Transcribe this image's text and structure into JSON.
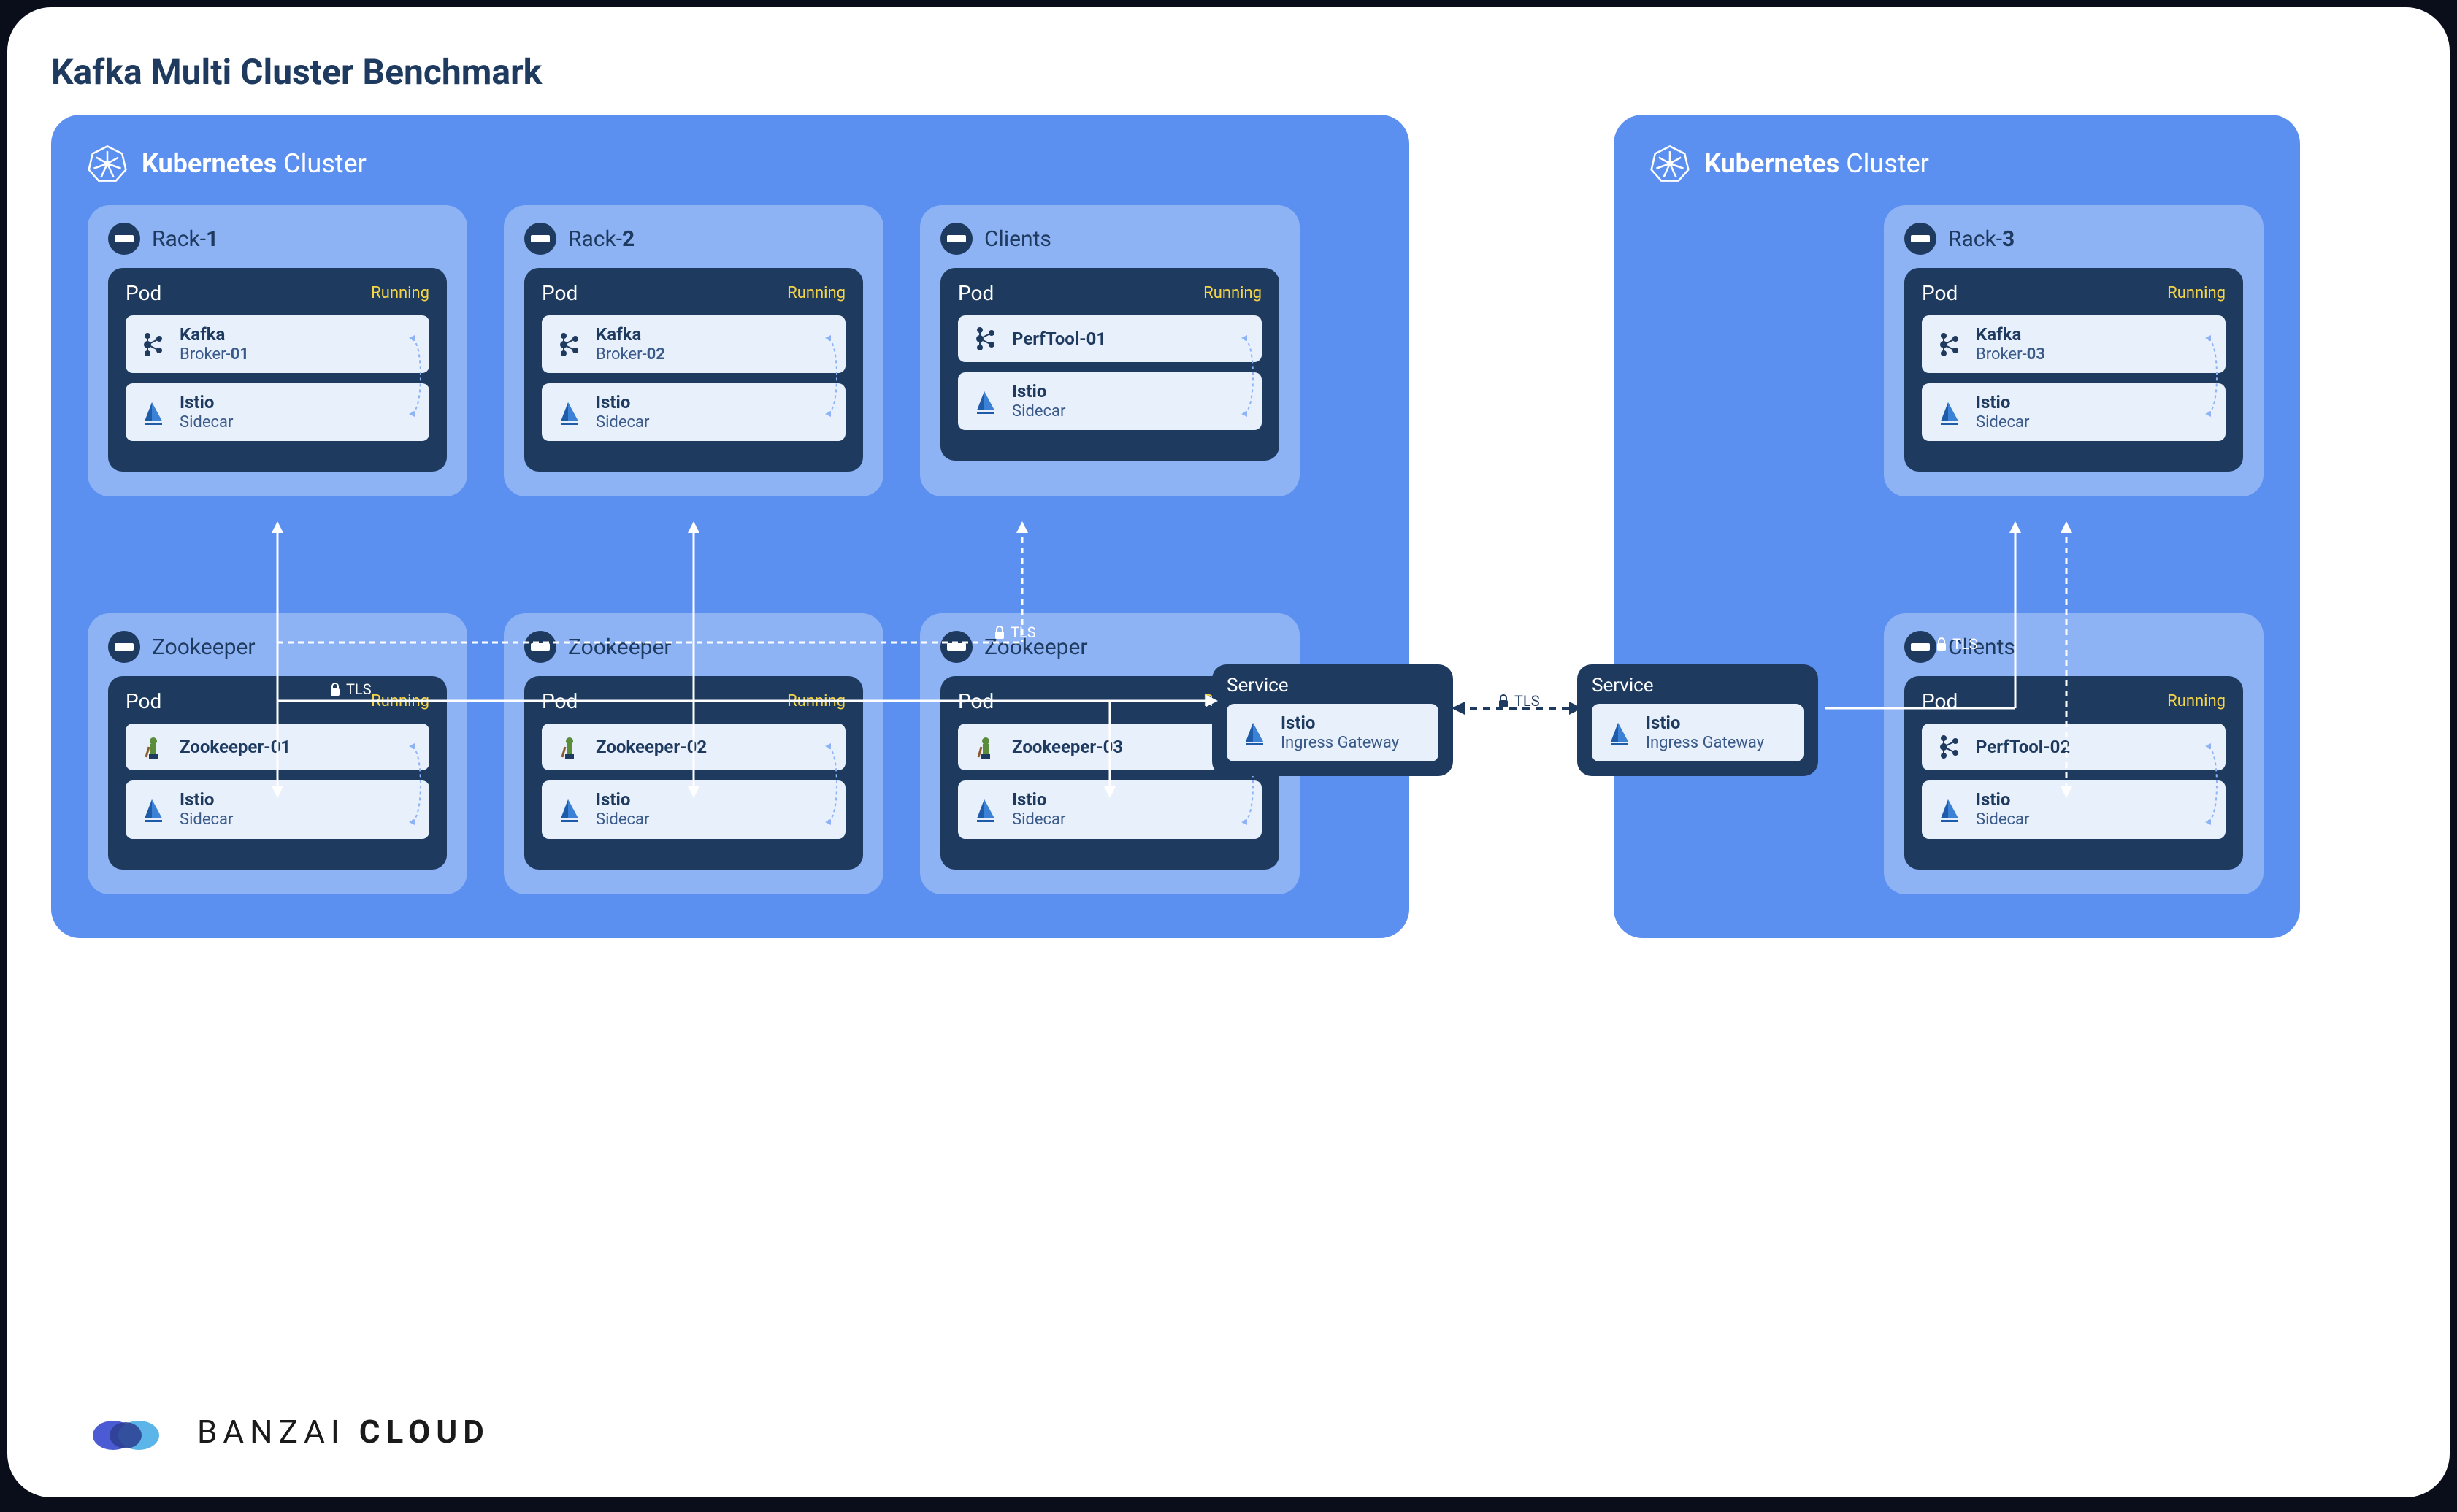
{
  "title": "Kafka Multi Cluster Benchmark",
  "clusters": {
    "left": {
      "name_bold": "Kubernetes",
      "name_rest": " Cluster"
    },
    "right": {
      "name_bold": "Kubernetes",
      "name_rest": " Cluster"
    }
  },
  "racks": {
    "rack1": {
      "prefix": "Rack-",
      "num": "1"
    },
    "rack2": {
      "prefix": "Rack-",
      "num": "2"
    },
    "rack3": {
      "prefix": "Rack-",
      "num": "3"
    },
    "clients_left": {
      "label": "Clients"
    },
    "clients_right": {
      "label": "Clients"
    },
    "zk1": {
      "label": "Zookeeper"
    },
    "zk2": {
      "label": "Zookeeper"
    },
    "zk3": {
      "label": "Zookeeper"
    }
  },
  "pod": {
    "label": "Pod",
    "status": "Running"
  },
  "components": {
    "kafka": {
      "name": "Kafka",
      "sub_prefix": "Broker-"
    },
    "broker01": "01",
    "broker02": "02",
    "broker03": "03",
    "istio": {
      "name": "Istio",
      "sub": "Sidecar"
    },
    "istio_gw": {
      "name": "Istio",
      "sub": "Ingress Gateway"
    },
    "perftool01": "PerfTool-01",
    "perftool02": "PerfTool-02",
    "zk01": "Zookeeper-01",
    "zk02": "Zookeeper-02",
    "zk03": "Zookeeper-03"
  },
  "service": {
    "label": "Service"
  },
  "tls": "TLS",
  "logo": {
    "part1": "BANZAI ",
    "part2": "CLOUD"
  },
  "colors": {
    "cluster_bg": "#5b8ff0",
    "rack_bg": "#8eb3f5",
    "pod_bg": "#1e3a5f",
    "component_bg": "#e8f0fc",
    "status": "#f5d547"
  }
}
